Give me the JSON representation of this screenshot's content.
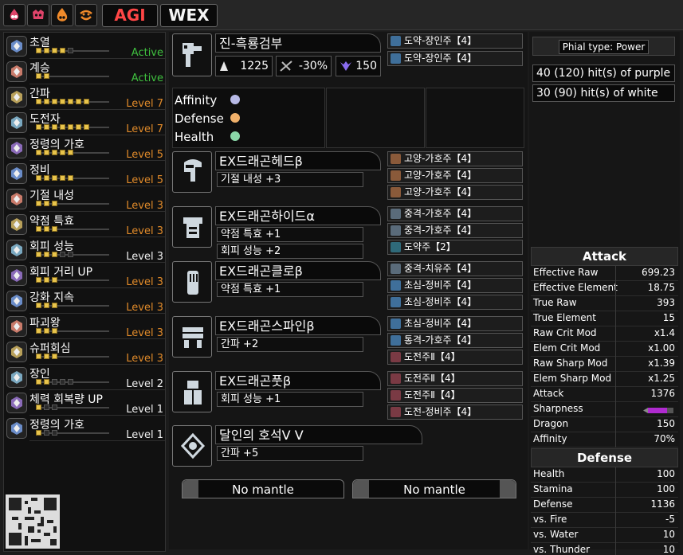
{
  "set_tabs": {
    "agi": "AGI",
    "wex": "WEX"
  },
  "mode_icons": [
    "fire-icon",
    "dragon-face-icon",
    "fire-icon",
    "smile-icon"
  ],
  "skills": [
    {
      "name": "초열",
      "pips": 4,
      "max": 5,
      "status": "Active",
      "style": "active",
      "icon": "scroll-icon"
    },
    {
      "name": "계승",
      "pips": 2,
      "max": 2,
      "status": "Active",
      "style": "active",
      "icon": "scroll-icon"
    },
    {
      "name": "간파",
      "pips": 7,
      "max": 7,
      "status": "Level 7",
      "style": "orange",
      "icon": "gem-icon"
    },
    {
      "name": "도전자",
      "pips": 7,
      "max": 7,
      "status": "Level 7",
      "style": "orange",
      "icon": "gem-icon"
    },
    {
      "name": "정령의 가호",
      "pips": 5,
      "max": 5,
      "status": "Level 5",
      "style": "orange",
      "icon": "gem-icon"
    },
    {
      "name": "정비",
      "pips": 5,
      "max": 5,
      "status": "Level 5",
      "style": "orange",
      "icon": "gem-icon"
    },
    {
      "name": "기절 내성",
      "pips": 3,
      "max": 3,
      "status": "Level 3",
      "style": "orange",
      "icon": "gem-icon"
    },
    {
      "name": "약점 특효",
      "pips": 3,
      "max": 3,
      "status": "Level 3",
      "style": "orange",
      "icon": "gem-icon"
    },
    {
      "name": "회피 성능",
      "pips": 3,
      "max": 5,
      "status": "Level 3",
      "style": "white",
      "icon": "gem-icon"
    },
    {
      "name": "회피 거리 UP",
      "pips": 3,
      "max": 3,
      "status": "Level 3",
      "style": "orange",
      "icon": "gem-icon"
    },
    {
      "name": "강화 지속",
      "pips": 3,
      "max": 3,
      "status": "Level 3",
      "style": "orange",
      "icon": "gem-icon"
    },
    {
      "name": "파괴왕",
      "pips": 3,
      "max": 3,
      "status": "Level 3",
      "style": "orange",
      "icon": "gem-icon"
    },
    {
      "name": "슈퍼회심",
      "pips": 3,
      "max": 3,
      "status": "Level 3",
      "style": "orange",
      "icon": "gem-icon"
    },
    {
      "name": "장인",
      "pips": 2,
      "max": 5,
      "status": "Level 2",
      "style": "white",
      "icon": "gem-icon"
    },
    {
      "name": "체력 회복량 UP",
      "pips": 1,
      "max": 3,
      "status": "Level 1",
      "style": "white",
      "icon": "gem-icon"
    },
    {
      "name": "정령의 가호",
      "pips": 1,
      "max": 3,
      "status": "Level 1",
      "style": "white",
      "icon": "gem-icon"
    }
  ],
  "weapon": {
    "name": "진-흑룡검부",
    "attack": "1225",
    "affinity": "-30%",
    "element": "150",
    "decorations": [
      "도약-장인주【4】",
      "도약-장인주【4】"
    ],
    "bonus": {
      "affinity": "Affinity",
      "defense": "Defense",
      "health": "Health"
    }
  },
  "armor": [
    {
      "name": "EX드래곤헤드β",
      "skills": [
        "기절 내성 +3"
      ],
      "decorations": [
        "고양-가호주【4】",
        "고양-가호주【4】",
        "고양-가호주【4】"
      ],
      "icon": "helm-icon"
    },
    {
      "name": "EX드래곤하이드α",
      "skills": [
        "약점 특효 +1",
        "회피 성능 +2"
      ],
      "decorations": [
        "중격-가호주【4】",
        "중격-가호주【4】",
        "도약주【2】"
      ],
      "icon": "chest-icon"
    },
    {
      "name": "EX드래곤클로β",
      "skills": [
        "약점 특효 +1"
      ],
      "decorations": [
        "중격-치유주【4】",
        "초심-정비주【4】",
        "초심-정비주【4】"
      ],
      "icon": "gauntlet-icon"
    },
    {
      "name": "EX드래곤스파인β",
      "skills": [
        "간파 +2"
      ],
      "decorations": [
        "초심-정비주【4】",
        "통격-가호주【4】",
        "도전주Ⅱ【4】"
      ],
      "icon": "waist-icon"
    },
    {
      "name": "EX드래곤풋β",
      "skills": [
        "회피 성능 +1"
      ],
      "decorations": [
        "도전주Ⅱ【4】",
        "도전주Ⅱ【4】",
        "도전-정비주【4】"
      ],
      "icon": "boots-icon"
    }
  ],
  "charm": {
    "name": "달인의 호석Ⅴ Ⅴ",
    "skills": [
      "간파 +5"
    ]
  },
  "mantles": [
    "No mantle",
    "No mantle"
  ],
  "phial": {
    "type": "Phial type: Power",
    "purple_hits": "40 (120) hit(s) of purple",
    "white_hits": "30 (90) hit(s) of white"
  },
  "attack_stats": {
    "title": "Attack",
    "rows": [
      {
        "label": "Effective Raw",
        "value": "699.23"
      },
      {
        "label": "Effective Element",
        "value": "18.75"
      },
      {
        "label": "True Raw",
        "value": "393"
      },
      {
        "label": "True Element",
        "value": "15"
      },
      {
        "label": "Raw Crit Mod",
        "value": "x1.4"
      },
      {
        "label": "Elem Crit Mod",
        "value": "x1.00"
      },
      {
        "label": "Raw Sharp Mod",
        "value": "x1.39"
      },
      {
        "label": "Elem Sharp Mod",
        "value": "x1.25"
      },
      {
        "label": "Attack",
        "value": "1376"
      },
      {
        "label": "Sharpness",
        "value": ""
      },
      {
        "label": "Dragon",
        "value": "150"
      },
      {
        "label": "Affinity",
        "value": "70%"
      }
    ]
  },
  "defense_stats": {
    "title": "Defense",
    "rows": [
      {
        "label": "Health",
        "value": "100"
      },
      {
        "label": "Stamina",
        "value": "100"
      },
      {
        "label": "Defense",
        "value": "1136"
      },
      {
        "label": "vs. Fire",
        "value": "-5"
      },
      {
        "label": "vs. Water",
        "value": "10"
      },
      {
        "label": "vs. Thunder",
        "value": "10"
      }
    ]
  },
  "colors": {
    "active": "#3fc03f",
    "level_orange": "#e08a2a",
    "agi_red": "#ff4646",
    "sharpness_purple": "#b02bd0"
  }
}
